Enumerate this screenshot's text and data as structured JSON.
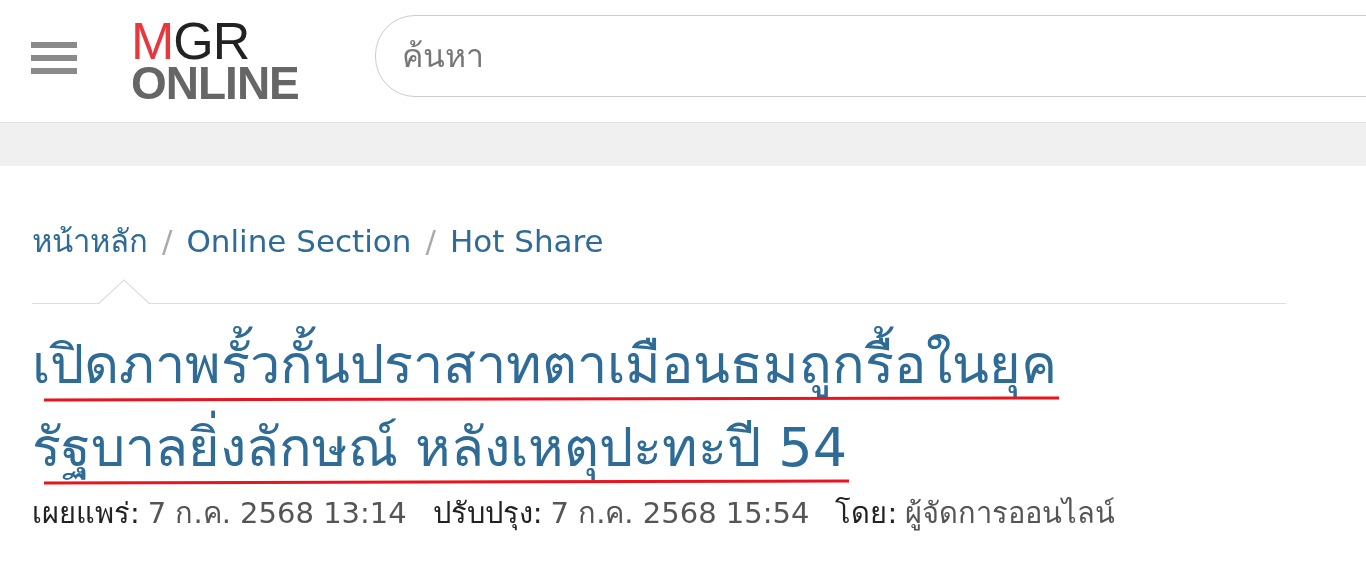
{
  "header": {
    "logo": {
      "line_1": [
        {
          "text": "M",
          "color": "#e8383d"
        },
        {
          "text": "GR",
          "color": "#222222"
        }
      ],
      "line_2": "ONLINE"
    },
    "search": {
      "placeholder": "ค้นหา"
    }
  },
  "breadcrumb": [
    "หน้าหลัก",
    "/",
    "Online Section",
    "/",
    "Hot Share"
  ],
  "article": {
    "title_lines": [
      {
        "text": "เปิดภาพรั้วกั้นปราสาทตาเมือนธมถูกรื้อในยุค",
        "underlined": true
      },
      {
        "text": "รัฐบาลยิ่งลักษณ์ หลังเหตุปะทะปี 54",
        "underlined": true
      }
    ],
    "meta": [
      {
        "label": "เผยแพร่:",
        "value": "7 ก.ค. 2568 13:14"
      },
      {
        "label": "ปรับปรุง:",
        "value": "7 ก.ค. 2568 15:54"
      },
      {
        "label": "โดย:",
        "value": "ผู้จัดการออนไลน์"
      }
    ]
  }
}
